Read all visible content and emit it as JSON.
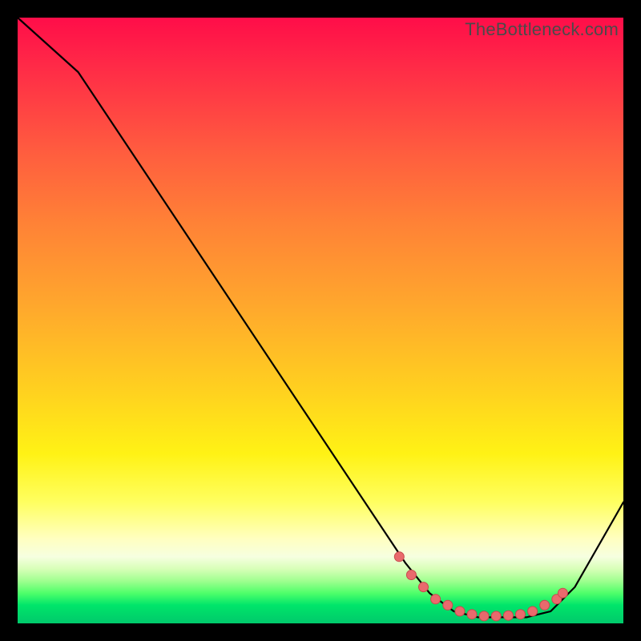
{
  "attribution": "TheBottleneck.com",
  "colors": {
    "dot_fill": "#e96a6d",
    "dot_stroke": "#c84a4d",
    "curve": "#000000"
  },
  "chart_data": {
    "type": "line",
    "title": "",
    "xlabel": "",
    "ylabel": "",
    "xlim": [
      0,
      100
    ],
    "ylim": [
      0,
      100
    ],
    "series": [
      {
        "name": "curve",
        "x": [
          0,
          10,
          64,
          68,
          72,
          76,
          80,
          84,
          88,
          92,
          100
        ],
        "y": [
          100,
          91,
          10,
          5,
          2,
          1,
          1,
          1,
          2,
          6,
          20
        ]
      }
    ],
    "markers": {
      "name": "highlighted-points",
      "x": [
        63,
        65,
        67,
        69,
        71,
        73,
        75,
        77,
        79,
        81,
        83,
        85,
        87,
        89,
        90
      ],
      "y": [
        11,
        8,
        6,
        4,
        3,
        2,
        1.5,
        1.2,
        1.2,
        1.3,
        1.5,
        2,
        3,
        4,
        5
      ]
    }
  }
}
